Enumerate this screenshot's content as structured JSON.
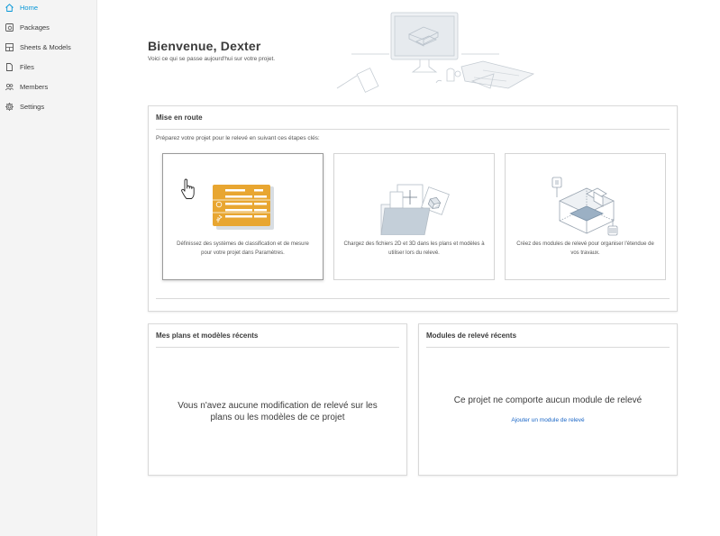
{
  "sidebar": {
    "items": [
      {
        "label": "Home",
        "icon": "home-icon",
        "active": true
      },
      {
        "label": "Packages",
        "icon": "packages-icon",
        "active": false
      },
      {
        "label": "Sheets & Models",
        "icon": "sheets-models-icon",
        "active": false
      },
      {
        "label": "Files",
        "icon": "file-icon",
        "active": false
      },
      {
        "label": "Members",
        "icon": "members-icon",
        "active": false
      },
      {
        "label": "Settings",
        "icon": "gear-icon",
        "active": false
      }
    ]
  },
  "welcome": {
    "title": "Bienvenue, Dexter",
    "subtitle": "Voici ce qui se passe aujourd'hui sur votre projet."
  },
  "getting_started": {
    "title": "Mise en route",
    "intro": "Préparez votre projet pour le relevé en suivant ces étapes clés:",
    "tiles": [
      {
        "text": "Définissez des systèmes de classification et de mesure pour votre projet dans Paramètres.",
        "icon": "classification-icon"
      },
      {
        "text": "Chargez des fichiers 2D et 3D dans les plans et modèles à utiliser lors du relevé.",
        "icon": "upload-files-icon"
      },
      {
        "text": "Créez des modules de relevé pour organiser l'étendue de vos travaux.",
        "icon": "takeoff-package-icon"
      }
    ]
  },
  "recent_plans": {
    "title": "Mes plans et modèles récents",
    "empty_message": "Vous n'avez aucune modification de relevé sur les plans ou les modèles de ce projet"
  },
  "recent_modules": {
    "title": "Modules de relevé récents",
    "empty_message": "Ce projet ne comporte aucun module de relevé",
    "link": "Ajouter un module de relevé"
  },
  "colors": {
    "accent": "#0696d7",
    "link": "#1a66c6",
    "tile_yellow": "#e8a631"
  }
}
